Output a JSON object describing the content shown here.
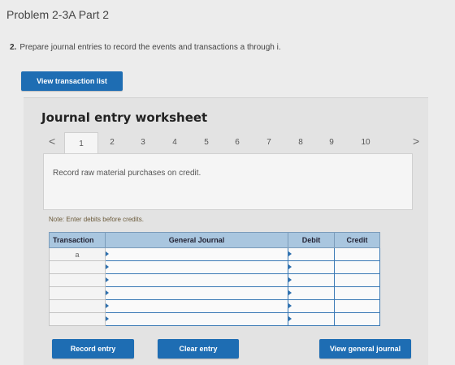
{
  "page": {
    "title": "Problem 2-3A Part 2"
  },
  "question": {
    "number": "2.",
    "text": "Prepare journal entries to record the events and transactions a through i."
  },
  "buttons": {
    "view_transaction_list": "View transaction list",
    "record_entry": "Record entry",
    "clear_entry": "Clear entry",
    "view_general_journal": "View general journal"
  },
  "worksheet": {
    "title": "Journal entry worksheet",
    "prev": "<",
    "next": ">",
    "tabs": [
      "1",
      "2",
      "3",
      "4",
      "5",
      "6",
      "7",
      "8",
      "9",
      "10"
    ],
    "active_tab": "1",
    "description": "Record raw material purchases on credit.",
    "note": "Note: Enter debits before credits."
  },
  "journal": {
    "headers": [
      "Transaction",
      "General Journal",
      "Debit",
      "Credit"
    ],
    "rows": [
      [
        "a",
        "",
        "",
        ""
      ],
      [
        "",
        "",
        "",
        ""
      ],
      [
        "",
        "",
        "",
        ""
      ],
      [
        "",
        "",
        "",
        ""
      ],
      [
        "",
        "",
        "",
        ""
      ],
      [
        "",
        "",
        "",
        ""
      ]
    ]
  },
  "colors": {
    "primary_button": "#1e6db3",
    "table_header": "#a9c6df",
    "input_border": "#3a79b5"
  }
}
